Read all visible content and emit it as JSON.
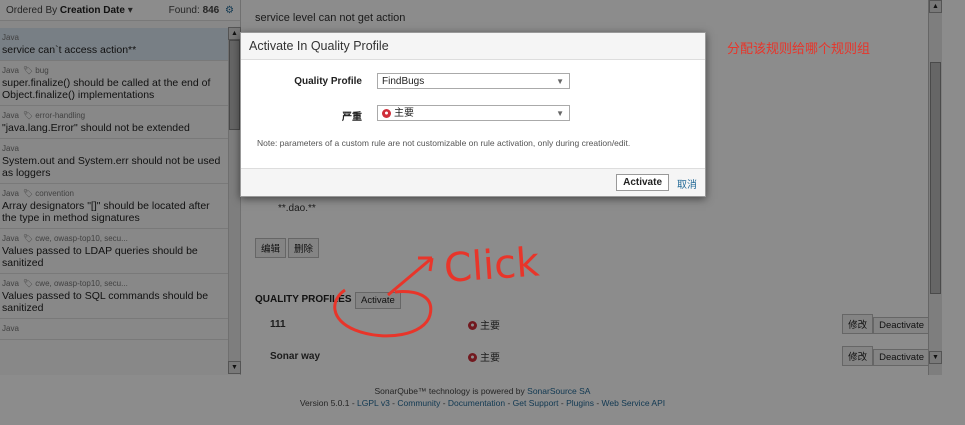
{
  "left_panel": {
    "order_prefix": "Ordered By",
    "order_value": "Creation Date",
    "found_label": "Found:",
    "found_count": "846",
    "rules": [
      {
        "lang": "Java",
        "tags": "",
        "name": "service can`t access action**"
      },
      {
        "lang": "Java",
        "tags": "bug",
        "name": "super.finalize() should be called at the end of Object.finalize() implementations"
      },
      {
        "lang": "Java",
        "tags": "error-handling",
        "name": "\"java.lang.Error\" should not be extended"
      },
      {
        "lang": "Java",
        "tags": "",
        "name": "System.out and System.err should not be used as loggers"
      },
      {
        "lang": "Java",
        "tags": "convention",
        "name": "Array designators \"[]\" should be located after the type in method signatures"
      },
      {
        "lang": "Java",
        "tags": "cwe, owasp-top10, secu...",
        "name": "Values passed to LDAP queries should be sanitized"
      },
      {
        "lang": "Java",
        "tags": "cwe, owasp-top10, secu...",
        "name": "Values passed to SQL commands should be sanitized"
      },
      {
        "lang": "Java",
        "tags": "",
        "name": ""
      }
    ]
  },
  "detail": {
    "description": "service level can not get action",
    "dao_text": "**.dao.**",
    "edit_label": "编辑",
    "delete_label": "删除",
    "quality_profiles_title": "QUALITY PROFILES",
    "activate_label": "Activate",
    "profiles": [
      {
        "name": "111",
        "severity": "主要",
        "modify": "修改",
        "deactivate": "Deactivate"
      },
      {
        "name": "Sonar way",
        "severity": "主要",
        "modify": "修改",
        "deactivate": "Deactivate"
      }
    ]
  },
  "annotation": {
    "chinese_note": "分配该规则给哪个规则组",
    "click_text": "Click"
  },
  "modal": {
    "title": "Activate In Quality Profile",
    "profile_label": "Quality Profile",
    "profile_value": "FindBugs",
    "severity_label": "严重",
    "severity_value": "主要",
    "note": "Note: parameters of a custom rule are not customizable on rule activation, only during creation/edit.",
    "activate_button": "Activate",
    "cancel_link": "取消"
  },
  "footer": {
    "line1_prefix": "SonarQube™ technology is powered by",
    "line1_link": "SonarSource SA",
    "version": "Version 5.0.1",
    "links": [
      "LGPL v3",
      "Community",
      "Documentation",
      "Get Support",
      "Plugins",
      "Web Service API"
    ]
  },
  "colors": {
    "accent": "#236a97",
    "severity": "#d02f3a",
    "annotation": "#e8352a",
    "selected_row": "#dbe7f2"
  }
}
